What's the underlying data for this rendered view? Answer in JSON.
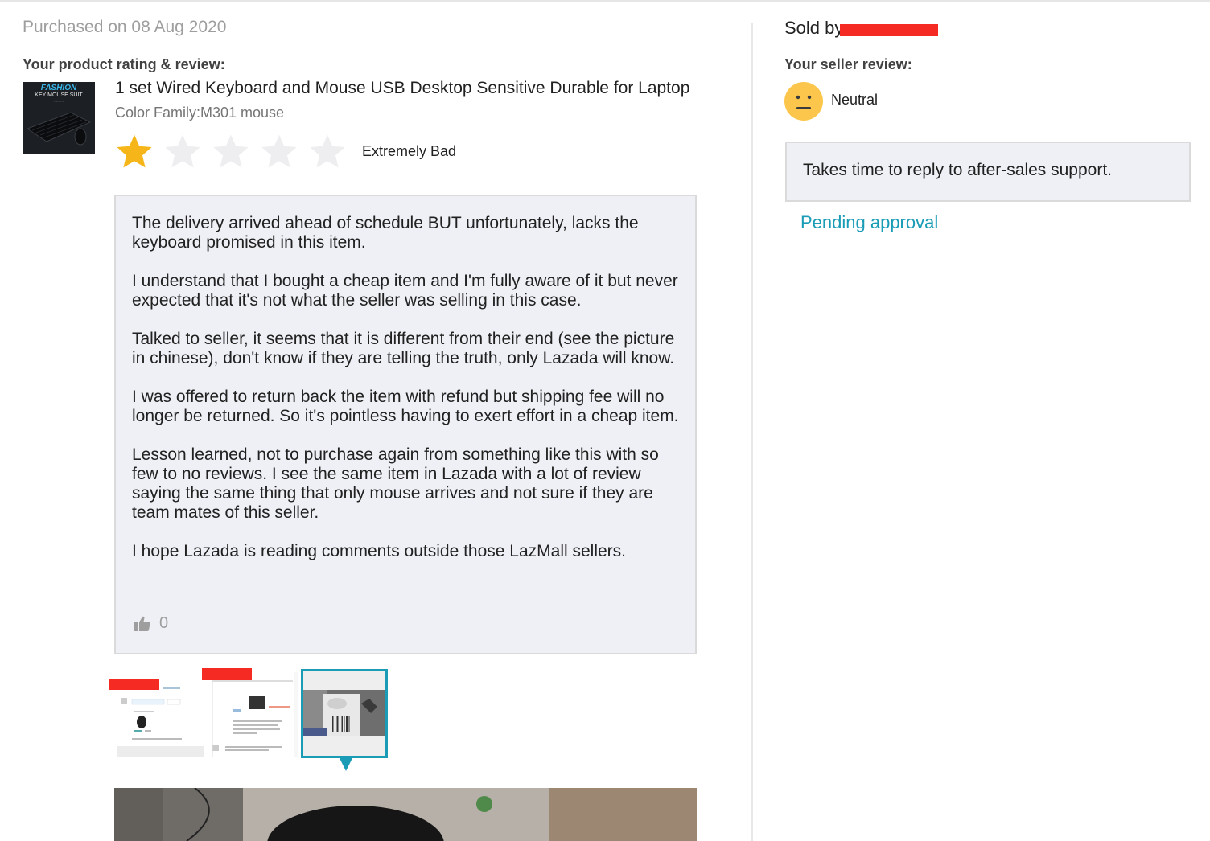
{
  "purchase": {
    "date_label": "Purchased on 08 Aug 2020"
  },
  "product_review": {
    "section_title": "Your product rating & review:",
    "product": {
      "thumbnail_text": [
        "FASHION",
        "KEY MOUSE SUIT",
        "·········"
      ],
      "title": "1 set Wired Keyboard and Mouse USB Desktop Sensitive Durable for Laptop",
      "variant": "Color Family:M301 mouse"
    },
    "rating": {
      "value": 1,
      "max": 5,
      "label": "Extremely Bad",
      "filled_color": "#f6b619",
      "empty_color": "#eeeef0"
    },
    "review_paragraphs": [
      "The delivery arrived ahead of schedule BUT unfortunately, lacks the keyboard promised in this item.",
      "I understand that I bought a cheap item and I'm fully aware of it but never expected that it's not what the seller was selling in this case.",
      "Talked to seller, it seems that it is different from their end (see the picture in chinese), don't know if they are telling the truth, only Lazada will know.",
      "I was offered to return back the item with refund but shipping fee will no longer be returned. So it's pointless having to exert effort in a cheap item.",
      "Lesson learned, not to purchase again from something like this with so few to no reviews. I see the same item in Lazada with a lot of review saying the same thing that only mouse arrives and not sure if they are team mates of this seller.",
      "I hope Lazada is reading comments outside those LazMall sellers."
    ],
    "likes": {
      "icon": "thumbs-up-icon",
      "count": "0"
    },
    "images": {
      "count": 3,
      "active_index": 2,
      "active_color": "#1a9cb7"
    }
  },
  "seller_review": {
    "sold_by_label": "Sold by",
    "section_title": "Your seller review:",
    "sentiment": {
      "icon": "neutral-face-icon",
      "label": "Neutral"
    },
    "comment": "Takes time to reply to after-sales support.",
    "status": "Pending approval",
    "link_color": "#1a9cb7",
    "redaction_color": "#f52a23"
  }
}
